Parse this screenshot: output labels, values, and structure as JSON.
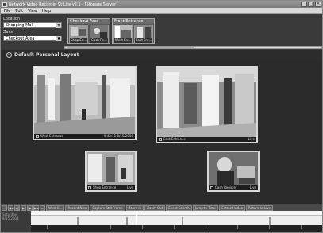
{
  "app": {
    "title": "Network Video Recorder 9t-Lite v2.1 - [Storage Server]",
    "window_buttons": [
      "_",
      "□",
      "×"
    ]
  },
  "menu": [
    "File",
    "Edit",
    "View",
    "Help"
  ],
  "location": {
    "label": "Location",
    "value": "Shopping Mall"
  },
  "zone": {
    "label": "Zone",
    "value": "Checkout Area"
  },
  "groups": [
    {
      "title": "Checkout Area",
      "thumbs": [
        "Shop En...",
        "Cash Re..."
      ]
    },
    {
      "title": "Front Entrance",
      "thumbs": [
        "West En...",
        "East Ent..."
      ]
    }
  ],
  "layout": {
    "title": "Default Personal Layout"
  },
  "cameras": [
    {
      "name": "West Entrance",
      "status": "9:43:11 8/15/2008"
    },
    {
      "name": "East Entrance",
      "status": "Live"
    },
    {
      "name": "Shop Entrance",
      "status": "Live"
    },
    {
      "name": "Cash Register",
      "status": "Live"
    }
  ],
  "controls": {
    "buttons": [
      "West E...",
      "Record Now",
      "Capture Still Frame",
      "Zoom In",
      "Zoom Out",
      "Event Search",
      "Jump to Time",
      "Extract Video",
      "Return to Live"
    ]
  },
  "timeline": {
    "left_label": "Saturday 8/15/2008",
    "marks": [
      "",
      "",
      "",
      ""
    ]
  },
  "colors": {
    "background": "#2b2b2b",
    "frame": "#d8d8d8",
    "accent": "#6c6c6c"
  }
}
